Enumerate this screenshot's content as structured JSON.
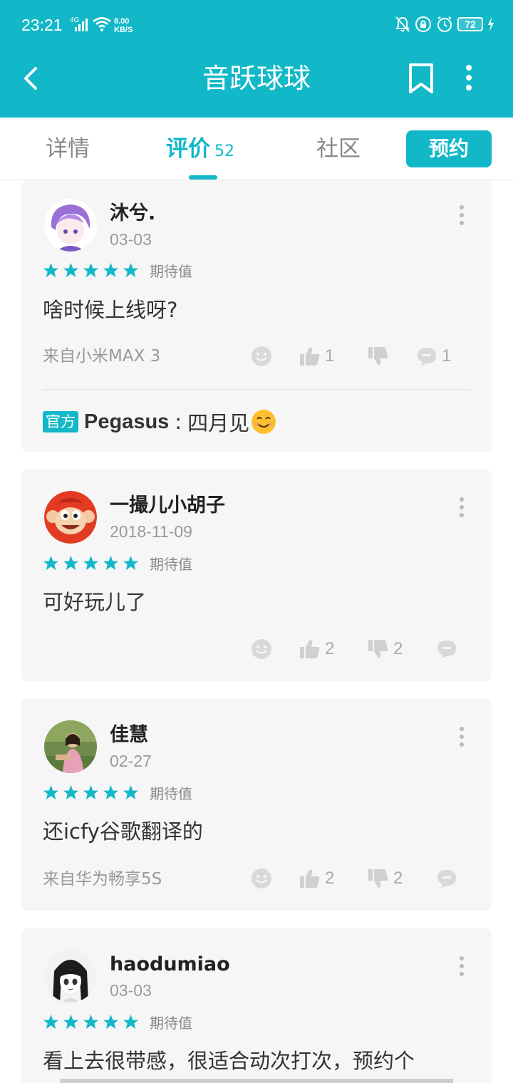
{
  "status_bar": {
    "time": "23:21",
    "network": "4G",
    "speed_value": "8.00",
    "speed_unit": "KB/S",
    "battery": "72"
  },
  "app_bar": {
    "title": "音跃球球",
    "back_icon": "back-arrow-icon",
    "bookmark_icon": "bookmark-icon",
    "more_icon": "more-vertical-icon"
  },
  "tabs": {
    "details": "详情",
    "reviews": "评价",
    "reviews_count": "52",
    "community": "社区",
    "reserve": "预约",
    "active": "reviews"
  },
  "colors": {
    "accent": "#13b8c8",
    "card_bg": "#f6f6f6"
  },
  "reviews": [
    {
      "user": "沐兮.",
      "date": "03-03",
      "rating": 5,
      "rating_label": "期待值",
      "text": "啥时候上线呀?",
      "device": "来自小米MAX 3",
      "likes": "1",
      "dislikes": "",
      "comments": "1",
      "official_reply": {
        "tag": "官方",
        "developer": "Pegasus",
        "separator": ":",
        "text": "四月见"
      }
    },
    {
      "user": "一撮儿小胡子",
      "date": "2018-11-09",
      "rating": 5,
      "rating_label": "期待值",
      "text": "可好玩儿了",
      "device": "",
      "likes": "2",
      "dislikes": "2",
      "comments": ""
    },
    {
      "user": "佳慧",
      "date": "02-27",
      "rating": 5,
      "rating_label": "期待值",
      "text": "还icfy谷歌翻译的",
      "device": "来自华为畅享5S",
      "likes": "2",
      "dislikes": "2",
      "comments": ""
    },
    {
      "user": "haodumiao",
      "date": "03-03",
      "rating": 5,
      "rating_label": "期待值",
      "text": "看上去很带感，很适合动次打次，预约个"
    }
  ]
}
